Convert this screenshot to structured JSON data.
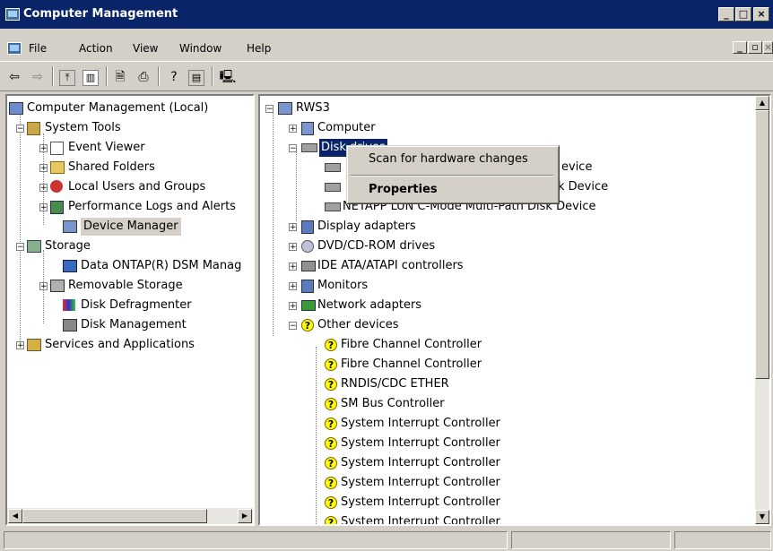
{
  "window": {
    "title": "Computer Management"
  },
  "menu": [
    "File",
    "Action",
    "View",
    "Window",
    "Help"
  ],
  "caption_buttons": {
    "minimize": "_",
    "maximize": "□",
    "close": "×"
  },
  "toolbar_icons": [
    "back-arrow-icon",
    "forward-arrow-icon",
    "up-folder-icon",
    "show-hide-tree-icon",
    "properties-icon",
    "print-icon",
    "help-icon",
    "console-view-icon",
    "device-manager-scan-icon"
  ],
  "left_tree": [
    {
      "label": "Computer Management (Local)"
    },
    {
      "label": "System Tools"
    },
    {
      "label": "Event Viewer"
    },
    {
      "label": "Shared Folders"
    },
    {
      "label": "Local Users and Groups"
    },
    {
      "label": "Performance Logs and Alerts"
    },
    {
      "label": "Device Manager"
    },
    {
      "label": "Storage"
    },
    {
      "label": "Data ONTAP(R) DSM Manag"
    },
    {
      "label": "Removable Storage"
    },
    {
      "label": "Disk Defragmenter"
    },
    {
      "label": "Disk Management"
    },
    {
      "label": "Services and Applications"
    }
  ],
  "right_tree": [
    {
      "label": "RWS3"
    },
    {
      "label": "Computer"
    },
    {
      "label": "Disk drives"
    },
    {
      "label": "evice"
    },
    {
      "label": "k Device"
    },
    {
      "label": "NETAPP LUN C-Mode  Multi-Path Disk Device"
    },
    {
      "label": "Display adapters"
    },
    {
      "label": "DVD/CD-ROM drives"
    },
    {
      "label": "IDE ATA/ATAPI controllers"
    },
    {
      "label": "Monitors"
    },
    {
      "label": "Network adapters"
    },
    {
      "label": "Other devices"
    },
    {
      "label": "Fibre Channel Controller"
    },
    {
      "label": "Fibre Channel Controller"
    },
    {
      "label": "RNDIS/CDC ETHER"
    },
    {
      "label": "SM Bus Controller"
    },
    {
      "label": "System Interrupt Controller"
    },
    {
      "label": "System Interrupt Controller"
    },
    {
      "label": "System Interrupt Controller"
    },
    {
      "label": "System Interrupt Controller"
    },
    {
      "label": "System Interrupt Controller"
    },
    {
      "label": "System Interrupt Controller"
    }
  ],
  "context_menu": {
    "scan": "Scan for hardware changes",
    "properties": "Properties"
  },
  "colors": {
    "titlebar": "#0a246a",
    "face": "#d4d0c8",
    "warning": "#ffff00"
  }
}
